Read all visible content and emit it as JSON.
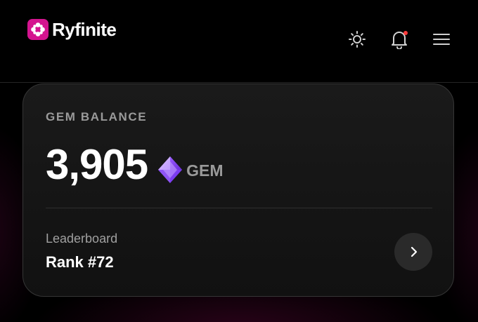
{
  "header": {
    "brand_name": "Ryfinite",
    "brand_color": "#d4148f",
    "icons": [
      "theme-toggle-sun-icon",
      "notifications-bell-icon",
      "menu-hamburger-icon"
    ],
    "notification_dot_color": "#ff3b3b"
  },
  "gem_card": {
    "title": "GEM BALANCE",
    "balance": "3,905",
    "unit": "GEM",
    "gem_icon": "gem-icon",
    "gem_color": "#a974ff",
    "leaderboard": {
      "label": "Leaderboard",
      "rank": "Rank #72",
      "action_icon": "chevron-right-icon"
    }
  }
}
